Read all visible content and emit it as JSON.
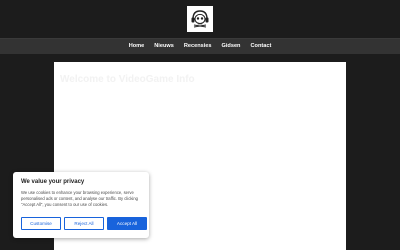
{
  "header": {
    "logo_icon": "skull-headphones-logo-icon"
  },
  "nav": {
    "items": [
      {
        "label": "Home"
      },
      {
        "label": "Nieuws"
      },
      {
        "label": "Recensies"
      },
      {
        "label": "Gidsen"
      },
      {
        "label": "Contact"
      }
    ]
  },
  "main": {
    "title": "Welcome to VideoGame Info"
  },
  "cookie_banner": {
    "title": "We value your privacy",
    "text": "We use cookies to enhance your browsing experience, serve personalised ads or content, and analyse our traffic. By clicking \"Accept All\", you consent to our use of cookies.",
    "customise_label": "Customise",
    "reject_label": "Reject All",
    "accept_label": "Accept All",
    "accent_color": "#1863dc"
  },
  "colors": {
    "background": "#1c1c1c",
    "navbar": "#333333",
    "content": "#ffffff"
  }
}
